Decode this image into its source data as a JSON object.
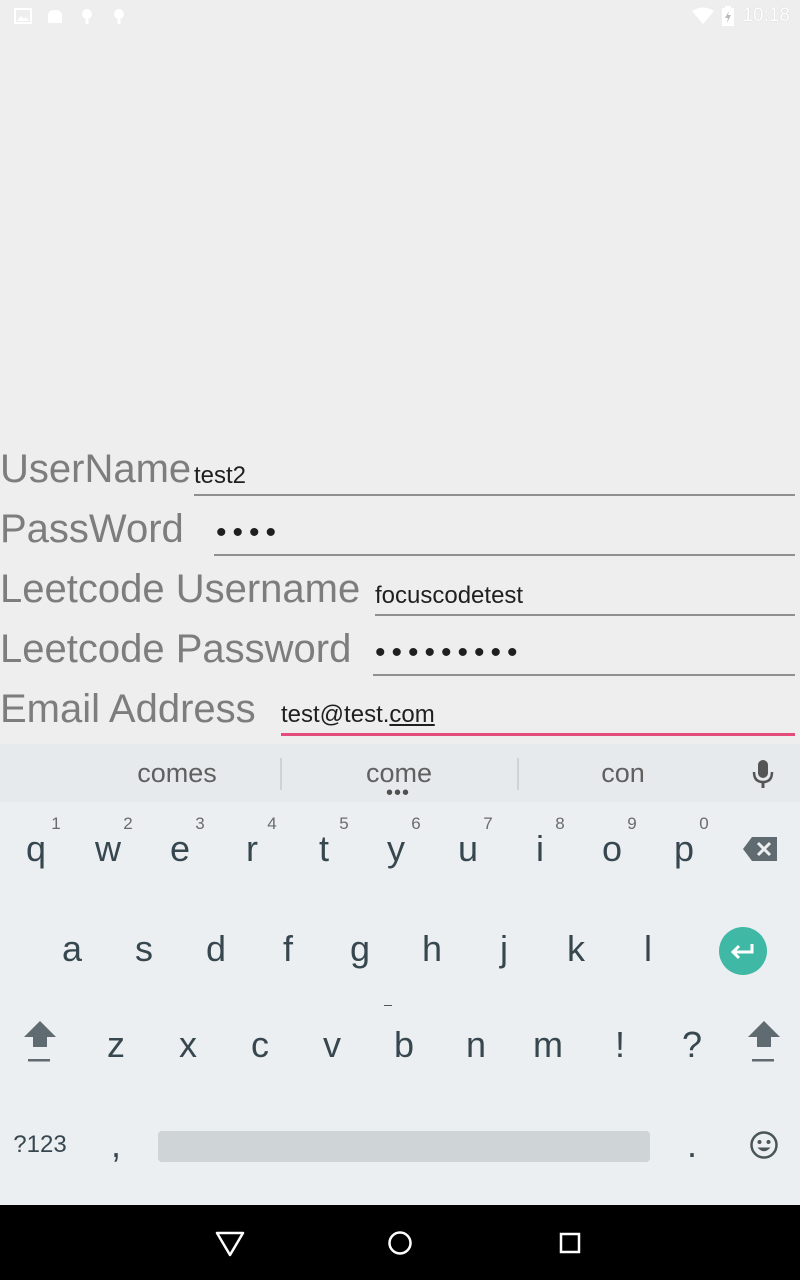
{
  "status_bar": {
    "time": "10:18",
    "left_icons": [
      "image-icon",
      "android-icon",
      "android-debug-icon",
      "bug-icon"
    ],
    "right_icons": [
      "wifi-icon",
      "battery-charging-icon"
    ]
  },
  "form": {
    "rows": [
      {
        "label": "UserName",
        "value": "test2",
        "type": "text"
      },
      {
        "label": "PassWord",
        "value": "••••",
        "type": "password"
      },
      {
        "label": "Leetcode Username",
        "value": "focuscodetest",
        "type": "text"
      },
      {
        "label": "Leetcode Password",
        "value": "•••••••••",
        "type": "password"
      },
      {
        "label": "Email Address",
        "value_prefix": "test@test.",
        "value_composing": "com",
        "type": "email"
      }
    ]
  },
  "keyboard": {
    "suggestions": [
      "comes",
      "come",
      "con"
    ],
    "more_suggestions_indicator": "•••",
    "row1": [
      "q",
      "w",
      "e",
      "r",
      "t",
      "y",
      "u",
      "i",
      "o",
      "p"
    ],
    "row1_hints": [
      "1",
      "2",
      "3",
      "4",
      "5",
      "6",
      "7",
      "8",
      "9",
      "0"
    ],
    "row2": [
      "a",
      "s",
      "d",
      "f",
      "g",
      "h",
      "j",
      "k",
      "l"
    ],
    "row3": [
      "z",
      "x",
      "c",
      "v",
      "b",
      "n",
      "m",
      "!",
      "?"
    ],
    "symbols_key": "?123",
    "comma_key": ",",
    "period_key": ".",
    "icons": {
      "mic": "microphone-icon",
      "backspace": "backspace-icon",
      "enter": "enter-icon",
      "shift": "shift-icon",
      "emoji": "emoji-icon"
    },
    "accent_color": "#3fb8a5"
  },
  "nav_bar": {
    "icons": [
      "back-icon",
      "home-icon",
      "recents-icon"
    ]
  },
  "colors": {
    "background": "#efeeef",
    "focused_underline": "#e44d7b",
    "label": "#7d7d7d"
  }
}
